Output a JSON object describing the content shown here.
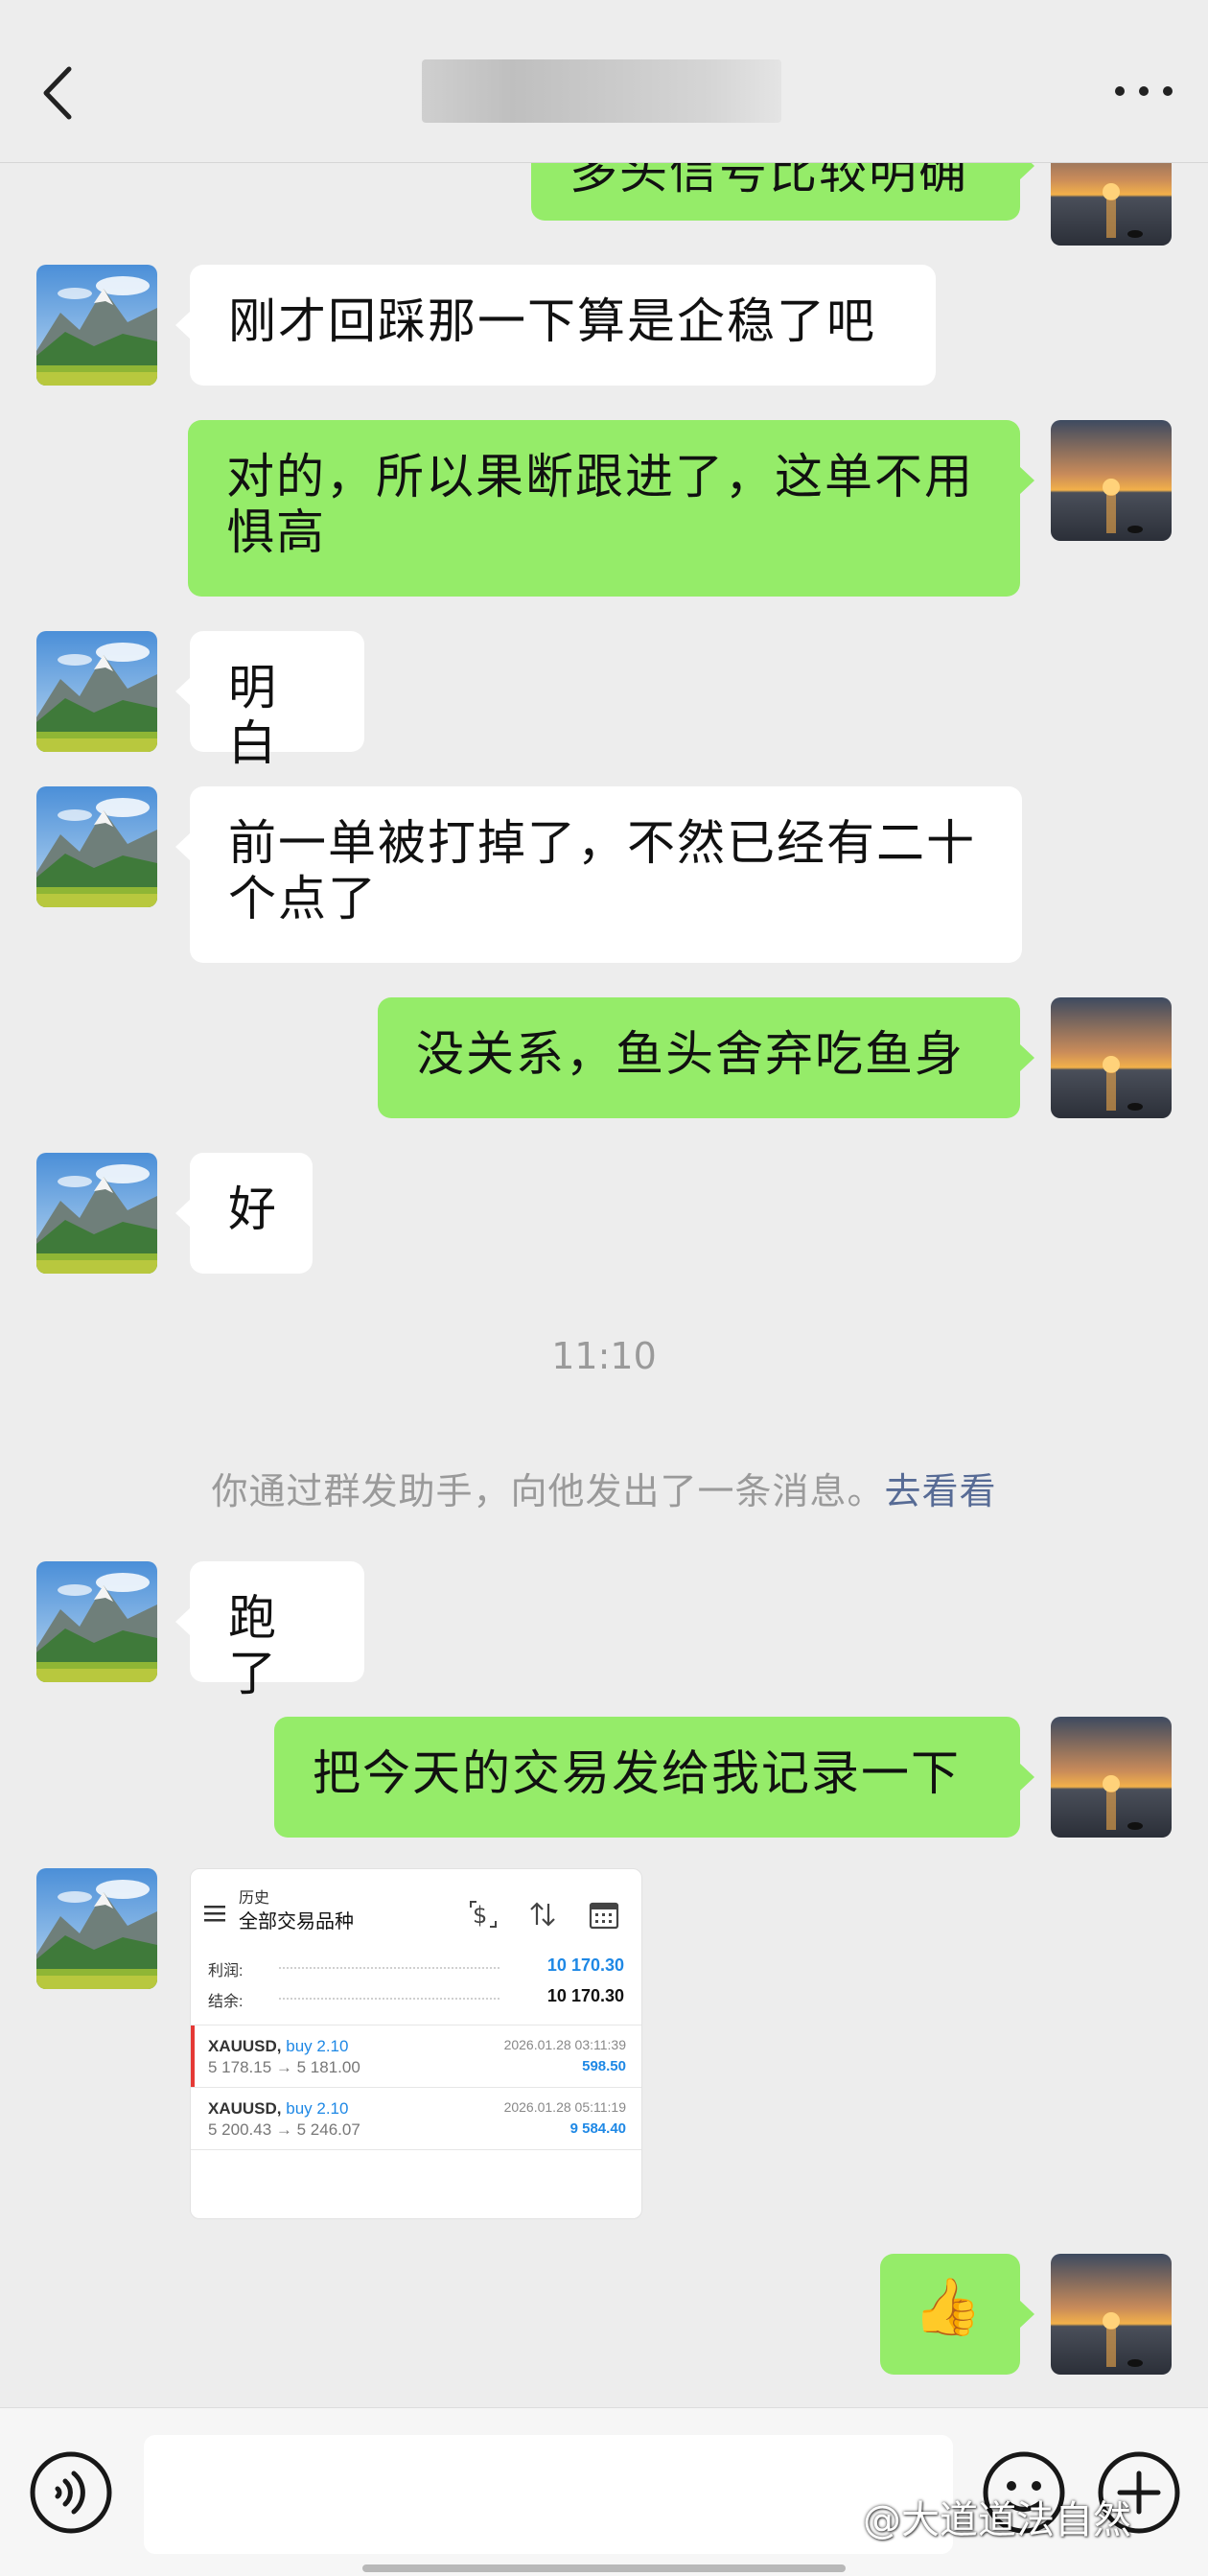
{
  "header": {
    "back_icon": "chevron-left-icon",
    "more_icon": "ellipsis-icon"
  },
  "messages": {
    "m0": "多头信号比较明确",
    "m1": "刚才回踩那一下算是企稳了吧",
    "m2": "对的，所以果断跟进了，这单不用惧高",
    "m3": "明白",
    "m4": "前一单被打掉了，不然已经有二十个点了",
    "m5": "没关系，鱼头舍弃吃鱼身",
    "m6": "好",
    "time": "11:10",
    "system_text": "你通过群发助手，向他发出了一条消息。",
    "system_link": "去看看",
    "m7": "跑了",
    "m8": "把今天的交易发给我记录一下",
    "m9": "👍"
  },
  "trade_card": {
    "small_label": "历史",
    "title": "全部交易品种",
    "profit_label": "利润:",
    "profit_value": "10 170.30",
    "balance_label": "结余:",
    "balance_value": "10 170.30",
    "trades": [
      {
        "symbol": "XAUUSD,",
        "side": "buy 2.10",
        "price": "5 178.15 → 5 181.00",
        "date": "2026.01.28 03:11:39",
        "pl": "598.50"
      },
      {
        "symbol": "XAUUSD,",
        "side": "buy 2.10",
        "price": "5 200.43 → 5 246.07",
        "date": "2026.01.28 05:11:19",
        "pl": "9 584.40"
      }
    ],
    "accent_color": "#1e88e5"
  },
  "input_bar": {
    "voice_icon": "voice-icon",
    "emoji_icon": "emoji-icon",
    "plus_icon": "plus-icon",
    "watermark": "@大道道法自然"
  },
  "colors": {
    "outgoing_bubble": "#95ec69",
    "incoming_bubble": "#ffffff",
    "background": "#ededed",
    "link": "#576b95"
  }
}
